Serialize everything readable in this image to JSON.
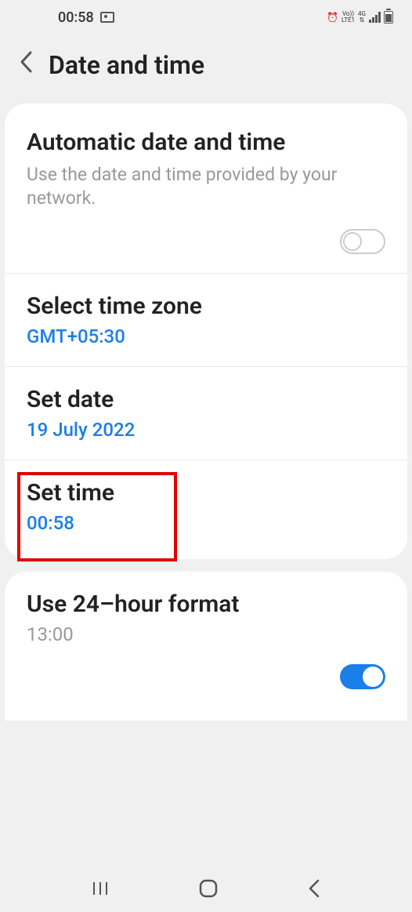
{
  "status_bar": {
    "time": "00:58",
    "network_label_1": "Vo))",
    "network_label_2": "LTE1",
    "network_label_3": "4G"
  },
  "header": {
    "title": "Date and time"
  },
  "settings": {
    "auto_datetime": {
      "title": "Automatic date and time",
      "desc": "Use the date and time provided by your network.",
      "enabled": false
    },
    "timezone": {
      "title": "Select time zone",
      "value": "GMT+05:30"
    },
    "set_date": {
      "title": "Set date",
      "value": "19 July 2022"
    },
    "set_time": {
      "title": "Set time",
      "value": "00:58"
    },
    "format_24h": {
      "title": "Use 24–hour format",
      "example": "13:00",
      "enabled": true
    }
  }
}
